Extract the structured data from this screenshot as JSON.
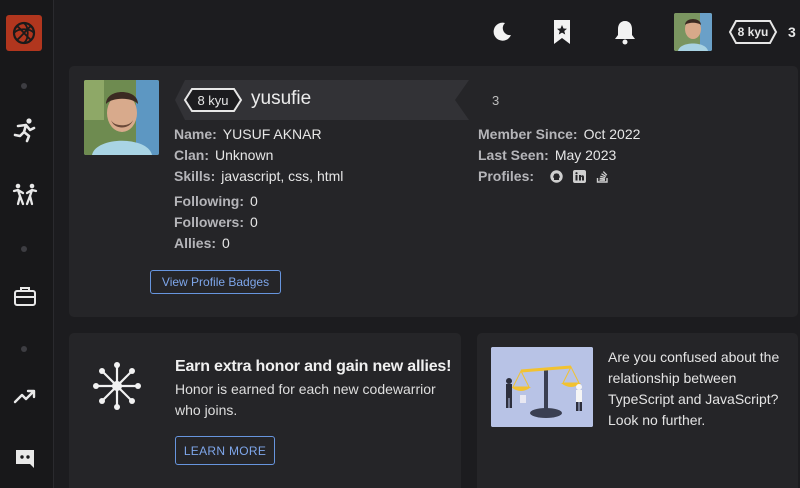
{
  "app": {
    "brand": "codewars"
  },
  "topbar": {
    "rank": "8 kyu",
    "honor": "3"
  },
  "profile": {
    "rank": "8 kyu",
    "username": "yusufie",
    "honor": "3",
    "name_label": "Name:",
    "name": "YUSUF AKNAR",
    "clan_label": "Clan:",
    "clan": "Unknown",
    "skills_label": "Skills:",
    "skills": "javascript, css, html",
    "following_label": "Following:",
    "following": "0",
    "followers_label": "Followers:",
    "followers": "0",
    "allies_label": "Allies:",
    "allies": "0",
    "member_since_label": "Member Since:",
    "member_since": "Oct 2022",
    "last_seen_label": "Last Seen:",
    "last_seen": "May 2023",
    "profiles_label": "Profiles:",
    "profile_links": [
      "github-icon",
      "linkedin-icon",
      "stackoverflow-icon"
    ],
    "badges_button": "View Profile Badges"
  },
  "promo_honor": {
    "title": "Earn extra honor and gain new allies!",
    "text": "Honor is earned for each new codewarrior who joins.",
    "button": "LEARN MORE"
  },
  "promo_article": {
    "text": "Are you confused about the relationship between TypeScript and JavaScript? Look no further."
  },
  "colors": {
    "accent": "#6795de",
    "brand": "#b1361e",
    "background": "#1c1c1f",
    "card": "#252528"
  }
}
